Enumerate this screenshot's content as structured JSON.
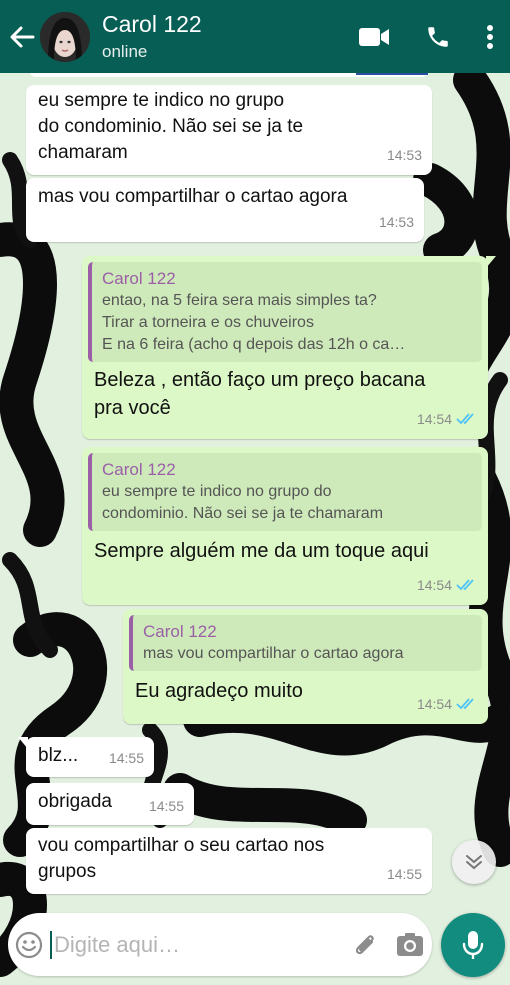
{
  "header": {
    "contact_name": "Carol 122",
    "status": "online",
    "bg_color": "#075e54"
  },
  "messages": [
    {
      "direction": "in",
      "lines": [
        "eu sempre te indico no grupo",
        "do condominio. Não sei se ja te",
        "chamaram"
      ],
      "time": "14:53"
    },
    {
      "direction": "in",
      "lines": [
        "mas vou compartilhar o cartao agora"
      ],
      "time": "14:53"
    },
    {
      "direction": "out",
      "quote": {
        "author": "Carol 122",
        "lines": [
          "entao, na 5 feira sera mais simples ta?",
          "Tirar a torneira e os chuveiros",
          "E na 6 feira (acho q depois das 12h o ca…"
        ]
      },
      "lines": [
        "Beleza , então faço um preço bacana",
        "pra você"
      ],
      "time": "14:54",
      "status": "read"
    },
    {
      "direction": "out",
      "quote": {
        "author": "Carol 122",
        "lines": [
          "eu sempre te indico no grupo do",
          "condominio. Não sei se ja te chamaram"
        ]
      },
      "lines": [
        "Sempre alguém me da um toque aqui"
      ],
      "time": "14:54",
      "status": "read"
    },
    {
      "direction": "out",
      "quote": {
        "author": "Carol 122",
        "lines": [
          "mas vou compartilhar o cartao agora"
        ]
      },
      "lines": [
        "Eu agradeço muito"
      ],
      "time": "14:54",
      "status": "read"
    },
    {
      "direction": "in",
      "lines": [
        "blz..."
      ],
      "time": "14:55"
    },
    {
      "direction": "in",
      "lines": [
        "obrigada"
      ],
      "time": "14:55"
    },
    {
      "direction": "in",
      "lines": [
        "vou compartilhar o seu cartao nos",
        "grupos"
      ],
      "time": "14:55"
    }
  ],
  "input": {
    "placeholder": "Digite aqui…",
    "value": ""
  },
  "colors": {
    "outgoing_bubble": "#dcf8c6",
    "incoming_bubble": "#ffffff",
    "quote_author": "#9a5fa7",
    "read_ticks": "#4fc3f7",
    "accent": "#128c7e"
  },
  "icons": {
    "back": "arrow-left-icon",
    "video": "video-camera-icon",
    "call": "phone-icon",
    "menu": "more-vert-icon",
    "emoji": "emoji-icon",
    "attach": "paperclip-icon",
    "camera": "camera-icon",
    "mic": "mic-icon",
    "scroll_down": "double-chevron-down-icon"
  }
}
